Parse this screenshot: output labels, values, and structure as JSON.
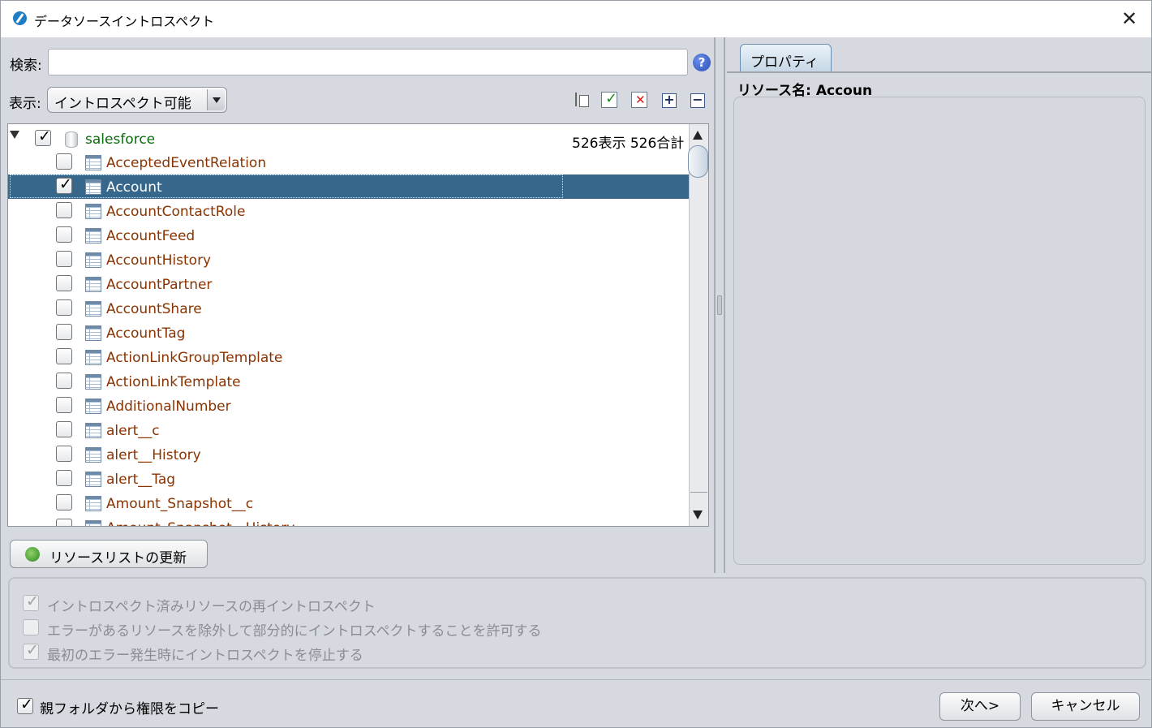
{
  "window": {
    "title": "データソースイントロスペクト",
    "close_label": "✕"
  },
  "search": {
    "label": "検索:",
    "value": "",
    "help_label": "?"
  },
  "view": {
    "label": "表示:",
    "selected": "イントロスペクト可能"
  },
  "tree": {
    "root": {
      "name": "salesforce",
      "checked": true,
      "count_text": "526表示 526合計"
    },
    "items": [
      {
        "name": "AcceptedEventRelation",
        "checked": false,
        "selected": false
      },
      {
        "name": "Account",
        "checked": true,
        "selected": true
      },
      {
        "name": "AccountContactRole",
        "checked": false,
        "selected": false
      },
      {
        "name": "AccountFeed",
        "checked": false,
        "selected": false
      },
      {
        "name": "AccountHistory",
        "checked": false,
        "selected": false
      },
      {
        "name": "AccountPartner",
        "checked": false,
        "selected": false
      },
      {
        "name": "AccountShare",
        "checked": false,
        "selected": false
      },
      {
        "name": "AccountTag",
        "checked": false,
        "selected": false
      },
      {
        "name": "ActionLinkGroupTemplate",
        "checked": false,
        "selected": false
      },
      {
        "name": "ActionLinkTemplate",
        "checked": false,
        "selected": false
      },
      {
        "name": "AdditionalNumber",
        "checked": false,
        "selected": false
      },
      {
        "name": "alert__c",
        "checked": false,
        "selected": false
      },
      {
        "name": "alert__History",
        "checked": false,
        "selected": false
      },
      {
        "name": "alert__Tag",
        "checked": false,
        "selected": false
      },
      {
        "name": "Amount_Snapshot__c",
        "checked": false,
        "selected": false
      },
      {
        "name": "Amount_Snapshot__History",
        "checked": false,
        "selected": false
      }
    ]
  },
  "refresh_button": {
    "label": "リソースリストの更新"
  },
  "properties": {
    "tab_label": "プロパティ",
    "resource_name": "リソース名: Accoun"
  },
  "options": [
    {
      "label": "イントロスペクト済みリソースの再イントロスペクト",
      "checked": true
    },
    {
      "label": "エラーがあるリソースを除外して部分的にイントロスペクトすることを許可する",
      "checked": false
    },
    {
      "label": "最初のエラー発生時にイントロスペクトを停止する",
      "checked": true
    }
  ],
  "footer": {
    "copy_label": "親フォルダから権限をコピー",
    "copy_checked": true,
    "next_label": "次へ>",
    "cancel_label": "キャンセル"
  }
}
